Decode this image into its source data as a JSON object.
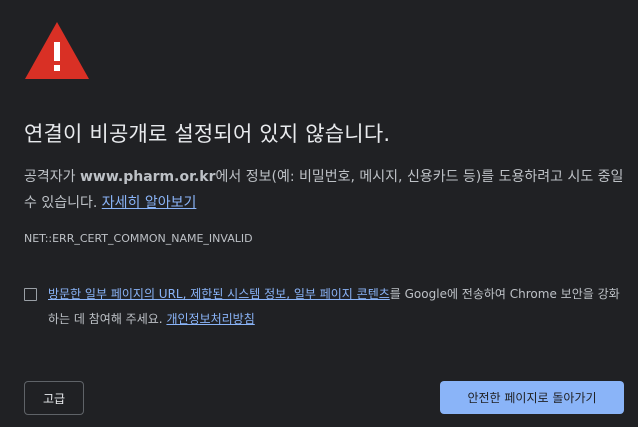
{
  "icons": {
    "warning": "warning-triangle-icon",
    "warning_color": "#d93025"
  },
  "title": "연결이 비공개로 설정되어 있지 않습니다.",
  "body": {
    "prefix": "공격자가 ",
    "domain": "www.pharm.or.kr",
    "suffix": "에서 정보(예: 비밀번호, 메시지, 신용카드 등)를 도용하려고 시도 중일 수 있습니다. ",
    "learn_more_link": "자세히 알아보기"
  },
  "error_code": "NET::ERR_CERT_COMMON_NAME_INVALID",
  "consent": {
    "checked": false,
    "link_text": "방문한 일부 페이지의 URL, 제한된 시스템 정보, 일부 페이지 콘텐츠",
    "text_after_link": "를 Google에 전송하여 Chrome 보안을 강화하는 데 참여해 주세요. ",
    "privacy_link": "개인정보처리방침"
  },
  "buttons": {
    "advanced": "고급",
    "back_to_safety": "안전한 페이지로 돌아가기"
  },
  "colors": {
    "background": "#202124",
    "accent": "#8ab4f8",
    "title_text": "#e8eaed",
    "body_text": "#bdc1c6"
  }
}
